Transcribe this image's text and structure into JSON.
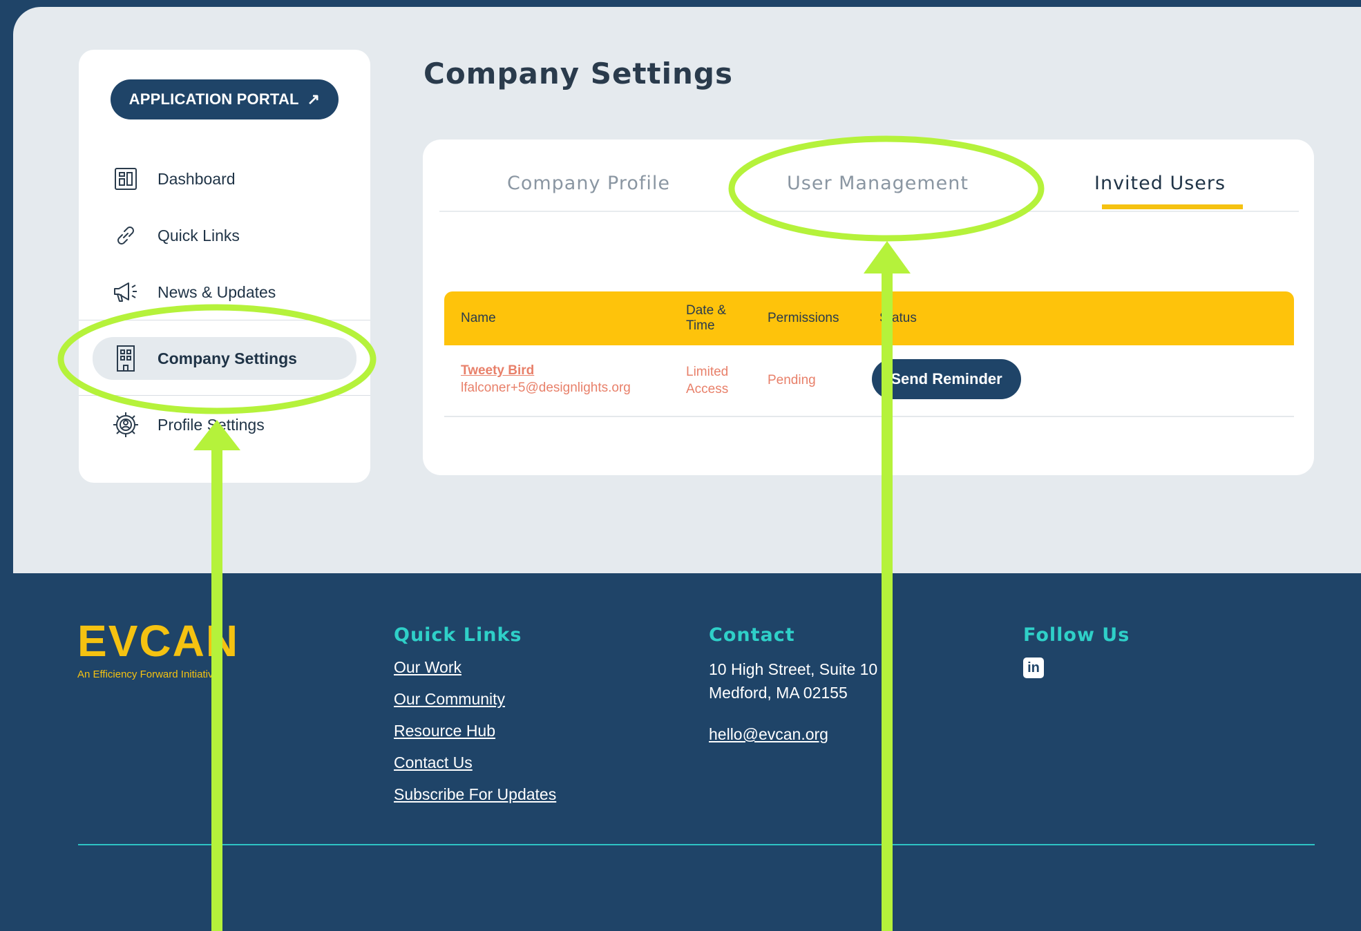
{
  "sidebar": {
    "portal_button": "APPLICATION PORTAL",
    "items": [
      {
        "label": "Dashboard",
        "icon": "dashboard-icon"
      },
      {
        "label": "Quick Links",
        "icon": "link-icon"
      },
      {
        "label": "News & Updates",
        "icon": "megaphone-icon"
      },
      {
        "label": "Company Settings",
        "icon": "building-icon",
        "active": true
      },
      {
        "label": "Profile Settings",
        "icon": "gear-icon"
      }
    ]
  },
  "main": {
    "title": "Company Settings",
    "tabs": [
      {
        "label": "Company Profile"
      },
      {
        "label": "User Management"
      },
      {
        "label": "Invited Users",
        "active": true
      }
    ],
    "table": {
      "headers": {
        "name": "Name",
        "date_line1": "Date &",
        "date_line2": "Time",
        "permissions": "Permissions",
        "status": "Status"
      },
      "rows": [
        {
          "name": "Tweety Bird",
          "email": "lfalconer+5@designlights.org",
          "permissions_line1": "Limited",
          "permissions_line2": "Access",
          "status": "Pending",
          "action": "Send Reminder"
        }
      ]
    }
  },
  "footer": {
    "logo_part1": "EVC",
    "logo_part2": "AN",
    "logo_tagline": "An Efficiency Forward Initiative",
    "quick_links_heading": "Quick Links",
    "quick_links": [
      "Our Work",
      "Our Community",
      "Resource Hub",
      "Contact Us",
      "Subscribe For Updates"
    ],
    "contact_heading": "Contact",
    "address_line1": "10 High Street, Suite 10",
    "address_line2": "Medford, MA 02155",
    "email": "hello@evcan.org",
    "follow_heading": "Follow Us",
    "social_icon_text": "in"
  },
  "colors": {
    "navy": "#1f4468",
    "accent_yellow": "#fec30b",
    "teal": "#2fd0c8",
    "annotation_green": "#b5f23b"
  }
}
